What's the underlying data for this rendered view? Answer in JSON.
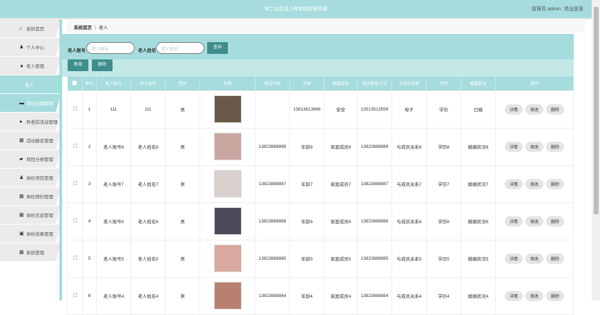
{
  "header": {
    "title": "常二社区线上养老院管理系统",
    "user": "管理员 admin",
    "logout": "退出登录"
  },
  "sidebar": {
    "items": [
      {
        "label": "系统首页",
        "icon": "home-icon",
        "g": "⌂"
      },
      {
        "label": "个人中心",
        "icon": "user-icon",
        "g": "♟"
      },
      {
        "label": "老人管理",
        "icon": "elder-icon",
        "g": "▲"
      },
      {
        "label": "老人",
        "icon": "",
        "g": ""
      },
      {
        "label": "活动主题管理",
        "icon": "card-icon",
        "g": "▬"
      },
      {
        "label": "养老院活动管理",
        "icon": "pin-icon",
        "g": "●"
      },
      {
        "label": "活动报名管理",
        "icon": "grid-icon",
        "g": "▦"
      },
      {
        "label": "项目分类管理",
        "icon": "briefcase-icon",
        "g": "▰"
      },
      {
        "label": "体检项目管理",
        "icon": "user-icon",
        "g": "♟"
      },
      {
        "label": "体检预约管理",
        "icon": "grid-icon",
        "g": "▦"
      },
      {
        "label": "体检信息管理",
        "icon": "grid-icon",
        "g": "▦"
      },
      {
        "label": "体检结果管理",
        "icon": "clipboard-icon",
        "g": "▣"
      },
      {
        "label": "系统管理",
        "icon": "grid-icon",
        "g": "▦"
      }
    ]
  },
  "breadcrumb": {
    "home": "系统首页",
    "sep": "⋮",
    "current": "老人"
  },
  "search": {
    "account_label": "老人账号",
    "account_placeholder": "老人账号",
    "name_label": "老人姓名",
    "name_placeholder": "老人姓名",
    "query": "查询",
    "add": "新增",
    "delete": "删除"
  },
  "table": {
    "headers": [
      "索引",
      "老人账号",
      "老人姓名",
      "性别",
      "头像",
      "电话号码",
      "年龄",
      "家庭成员",
      "成员联系方式",
      "与成员关系",
      "学历",
      "婚姻状况",
      "操作"
    ],
    "actions": [
      "详情",
      "修改",
      "删除"
    ],
    "rows": [
      [
        "1",
        "111",
        "111",
        "男",
        "",
        "13613613666",
        "安安",
        "13513513559",
        "母子",
        "学历",
        "已婚"
      ],
      [
        "2",
        "老人账号8",
        "老人姓名8",
        "男",
        "13823888888",
        "年龄8",
        "家庭成员8",
        "13823888888",
        "与成员关系8",
        "学历8",
        "婚姻状况8"
      ],
      [
        "3",
        "老人账号7",
        "老人姓名7",
        "男",
        "13823888887",
        "年龄7",
        "家庭成员7",
        "13823888887",
        "与成员关系7",
        "学历7",
        "婚姻状况7"
      ],
      [
        "4",
        "老人账号6",
        "老人姓名6",
        "男",
        "13823888886",
        "年龄6",
        "家庭成员6",
        "13823888886",
        "与成员关系6",
        "学历6",
        "婚姻状况6"
      ],
      [
        "5",
        "老人账号5",
        "老人姓名5",
        "男",
        "13823888885",
        "年龄5",
        "家庭成员5",
        "13823888885",
        "与成员关系5",
        "学历5",
        "婚姻状况5"
      ],
      [
        "6",
        "老人账号4",
        "老人姓名4",
        "男",
        "13823888884",
        "年龄4",
        "家庭成员4",
        "13823888884",
        "与成员关系4",
        "学历4",
        "婚姻状况4"
      ]
    ],
    "avatar_colors": [
      "#6b5a4a",
      "#c9a7a0",
      "#d8d0cc",
      "#4a4a58",
      "#d9a9a0",
      "#b88070"
    ]
  }
}
